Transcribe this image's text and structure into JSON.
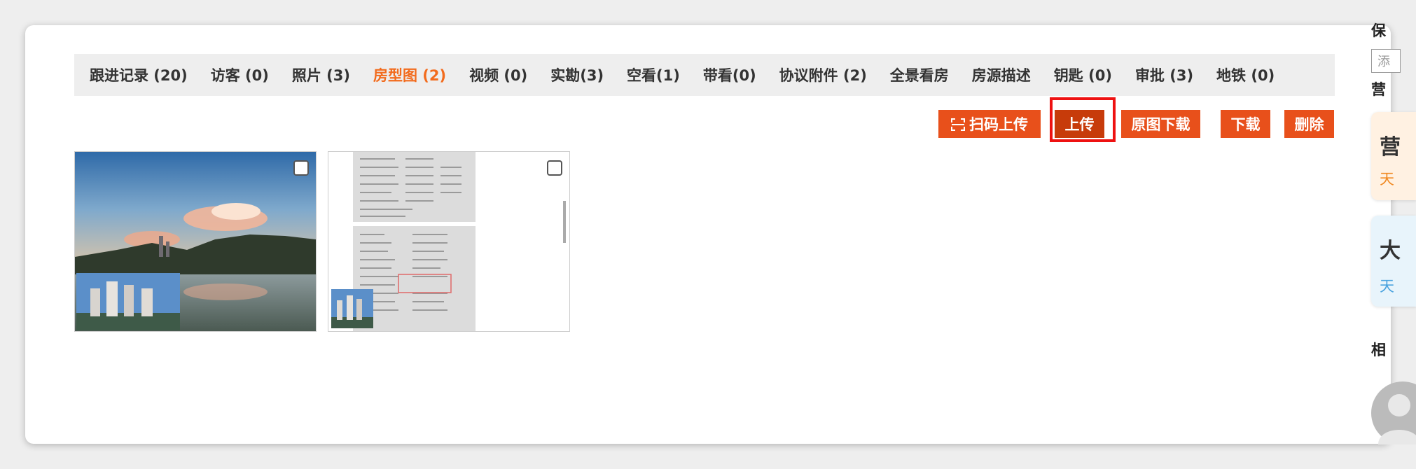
{
  "tabs": [
    {
      "label": "跟进记录 (20)",
      "active": false
    },
    {
      "label": "访客 (0)",
      "active": false
    },
    {
      "label": "照片 (3)",
      "active": false
    },
    {
      "label": "房型图 (2)",
      "active": true
    },
    {
      "label": "视频 (0)",
      "active": false
    },
    {
      "label": "实勘(3)",
      "active": false
    },
    {
      "label": "空看(1)",
      "active": false
    },
    {
      "label": "带看(0)",
      "active": false
    },
    {
      "label": "协议附件 (2)",
      "active": false
    },
    {
      "label": "全景看房",
      "active": false
    },
    {
      "label": "房源描述",
      "active": false
    },
    {
      "label": "钥匙 (0)",
      "active": false
    },
    {
      "label": "审批 (3)",
      "active": false
    },
    {
      "label": "地铁 (0)",
      "active": false
    }
  ],
  "actions": {
    "scan_upload": "扫码上传",
    "upload": "上传",
    "original_download": "原图下载",
    "download": "下载",
    "delete": "删除"
  },
  "colors": {
    "accent": "#e8501b",
    "active_tab": "#f26b1d",
    "highlight_box": "#ee1111"
  },
  "side": {
    "top_partial": "保",
    "input_partial": "添",
    "marketing_partial": "营",
    "card1_char": "营",
    "card1_sub": "天",
    "card2_char": "大",
    "card2_sub": "天",
    "related_partial": "相"
  }
}
